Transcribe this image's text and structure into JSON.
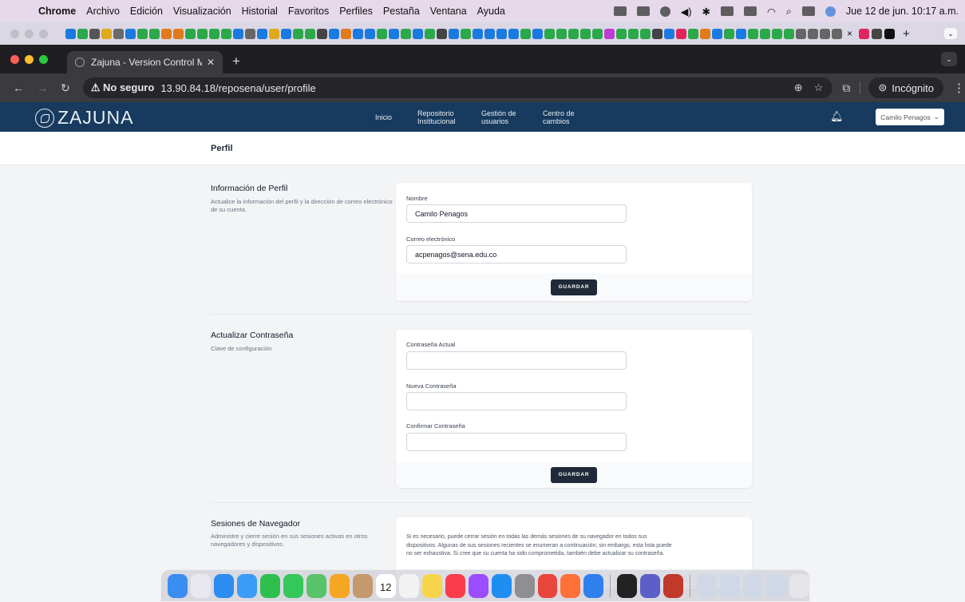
{
  "macbar": {
    "menus": [
      "Chrome",
      "Archivo",
      "Edición",
      "Visualización",
      "Historial",
      "Favoritos",
      "Perfiles",
      "Pestaña",
      "Ventana",
      "Ayuda"
    ],
    "datetime": "Jue 12 de jun.  10:17 a.m."
  },
  "favrow": {
    "close_label": "×",
    "new_label": "+"
  },
  "browser": {
    "tab_title": "Zajuna - Version Control Man",
    "not_secure": "No seguro",
    "url": "13.90.84.18/reposena/user/profile",
    "incognito": "Incógnito"
  },
  "appnav": {
    "logo": "ZAJUNA",
    "links": [
      {
        "line1": "Inicio",
        "line2": ""
      },
      {
        "line1": "Repositorio",
        "line2": "Institucional"
      },
      {
        "line1": "Gestión de",
        "line2": "usuarios"
      },
      {
        "line1": "Centro de",
        "line2": "cambios"
      }
    ],
    "user": "Camilo Penagos"
  },
  "page": {
    "title": "Perfil"
  },
  "profile": {
    "title": "Información de Perfil",
    "desc": "Actualice la información del perfil y la dirección de correo electrónico de su cuenta.",
    "name_label": "Nombre",
    "name_value": "Camilo Penagos",
    "email_label": "Correo electrónico",
    "email_value": "acpenagos@sena.edu.co",
    "save": "GUARDAR"
  },
  "password": {
    "title": "Actualizar Contraseña",
    "desc": "Clave de configuración",
    "current_label": "Contraseña Actual",
    "new_label": "Nueva Contraseña",
    "confirm_label": "Confirmar Contraseña",
    "save": "GUARDAR"
  },
  "sessions": {
    "title": "Sesiones de Navegador",
    "desc": "Administre y cierre sesión en sus sesiones activas en otros navegadores y dispositivos.",
    "text": "Si es necesario, puede cerrar sesión en todas las demás sesiones de su navegador en todos sus dispositivos. Algunas de sus sesiones recientes se enumeran a continuación; sin embargo, esta lista puede no ser exhaustiva. Si cree que su cuenta ha sido comprometida, también debe actualizar su contraseña."
  },
  "dock": {
    "calendar_day": "12"
  }
}
